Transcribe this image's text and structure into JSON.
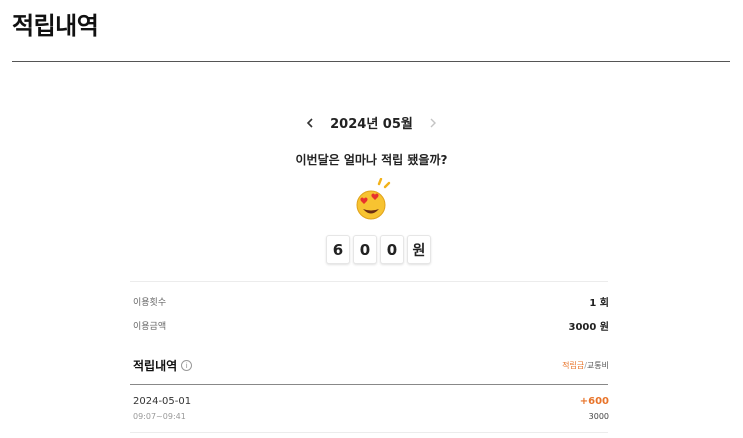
{
  "page": {
    "title": "적립내역"
  },
  "month_nav": {
    "prev_icon": "chevron-left-icon",
    "label": "2024년 05월",
    "next_icon": "chevron-right-icon"
  },
  "headline": "이번달은 얼마나 적립 됐을까?",
  "emoji": {
    "icon": "heart-eyes-emoji-icon"
  },
  "total": {
    "digits": [
      "6",
      "0",
      "0"
    ],
    "unit": "원"
  },
  "summary": {
    "usage_count": {
      "label": "이용횟수",
      "value": "1 회"
    },
    "usage_amount": {
      "label": "이용금액",
      "value": "3000 원"
    }
  },
  "history": {
    "title": "적립내역",
    "info_icon": "info-icon",
    "tab_active": "적립금",
    "tab_separator": "/",
    "tab_other": "교통비",
    "active_color": "#e8742a",
    "records": [
      {
        "date": "2024-05-01",
        "time": "09:07~09:41",
        "points": "+600",
        "fare": "3000"
      }
    ]
  }
}
